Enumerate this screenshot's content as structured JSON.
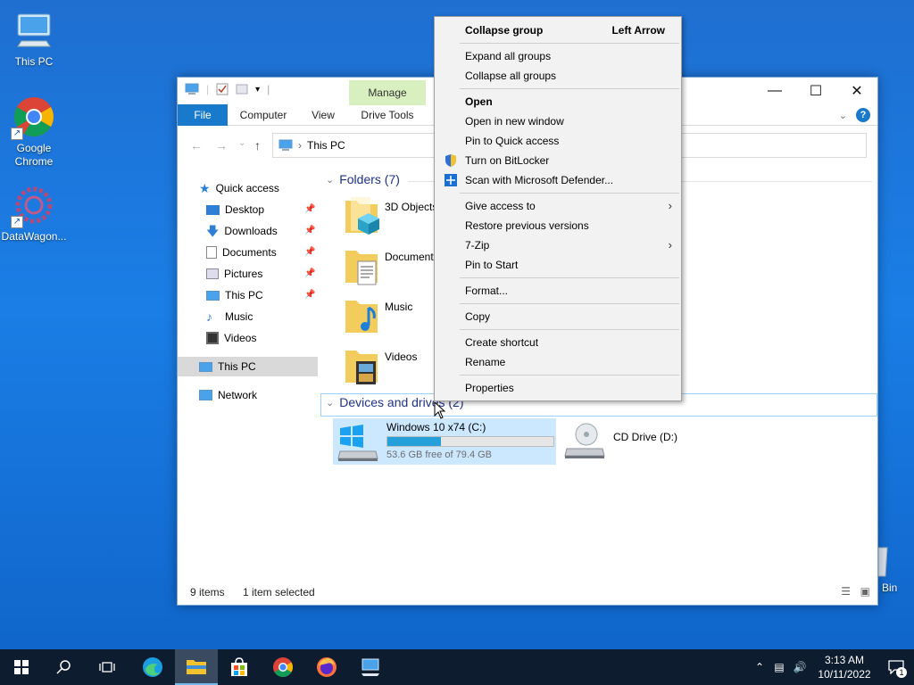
{
  "desktop": {
    "icons": [
      {
        "label": "This PC",
        "icon": "computer-icon"
      },
      {
        "label": "Google Chrome",
        "icon": "chrome-icon"
      },
      {
        "label": "DataWagon...",
        "icon": "datawagon-icon"
      }
    ],
    "recycle_bin_label": "Bin"
  },
  "explorer": {
    "manage_tab": "Manage",
    "ribbon_tabs": [
      "File",
      "Computer",
      "View",
      "Drive Tools"
    ],
    "address": "This PC",
    "nav": {
      "quick_access": "Quick access",
      "items": [
        {
          "label": "Desktop",
          "pinned": true
        },
        {
          "label": "Downloads",
          "pinned": true
        },
        {
          "label": "Documents",
          "pinned": true
        },
        {
          "label": "Pictures",
          "pinned": true
        },
        {
          "label": "This PC",
          "pinned": true
        },
        {
          "label": "Music",
          "pinned": false
        },
        {
          "label": "Videos",
          "pinned": false
        }
      ],
      "this_pc": "This PC",
      "network": "Network"
    },
    "folders_header": "Folders (7)",
    "folders": [
      "3D Objects",
      "Documents",
      "Music",
      "Videos"
    ],
    "devices_header": "Devices and drives (2)",
    "drives": [
      {
        "name": "Windows 10 x74 (C:)",
        "free_text": "53.6 GB free of 79.4 GB",
        "used_fraction": 0.325,
        "selected": true
      },
      {
        "name": "CD Drive (D:)"
      }
    ],
    "status": {
      "items": "9 items",
      "selected": "1 item selected"
    }
  },
  "context_menu": {
    "items": [
      {
        "label": "Collapse group",
        "shortcut": "Left Arrow",
        "bold": true
      },
      {
        "label": "Expand all groups"
      },
      {
        "label": "Collapse all groups"
      },
      {
        "label": "Open",
        "bold": true
      },
      {
        "label": "Open in new window"
      },
      {
        "label": "Pin to Quick access"
      },
      {
        "label": "Turn on BitLocker",
        "icon": "shield-icon"
      },
      {
        "label": "Scan with Microsoft Defender...",
        "icon": "defender-icon"
      },
      {
        "label": "Give access to",
        "submenu": true
      },
      {
        "label": "Restore previous versions"
      },
      {
        "label": "7-Zip",
        "submenu": true
      },
      {
        "label": "Pin to Start"
      },
      {
        "label": "Format..."
      },
      {
        "label": "Copy"
      },
      {
        "label": "Create shortcut"
      },
      {
        "label": "Rename"
      },
      {
        "label": "Properties"
      }
    ]
  },
  "taskbar": {
    "time": "3:13 AM",
    "date": "10/11/2022",
    "notification_count": "1"
  },
  "colors": {
    "accent": "#1979ca",
    "selection": "#cce8ff",
    "drive_fill": "#26a0da",
    "manage_bg": "#d8f0c0"
  }
}
